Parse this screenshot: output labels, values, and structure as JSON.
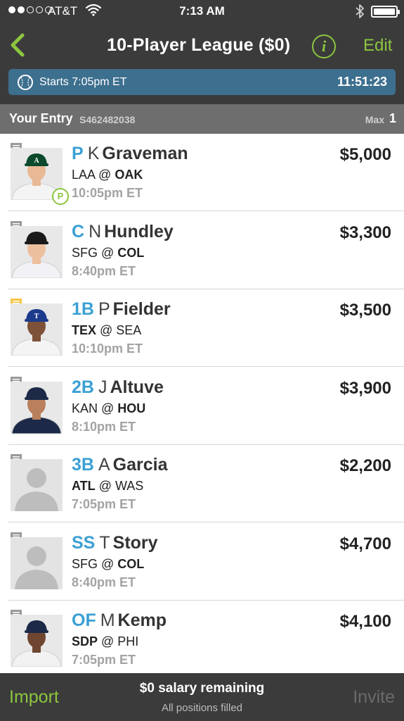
{
  "status_bar": {
    "carrier": "AT&T",
    "time": "7:13 AM",
    "signal_bars_filled": 2,
    "signal_bars_total": 5,
    "icons": [
      "wifi-icon",
      "bluetooth-icon",
      "battery-icon"
    ]
  },
  "nav": {
    "title": "10-Player League ($0)",
    "info_label": "i",
    "edit_label": "Edit",
    "icons": [
      "chevron-left-icon",
      "info-icon"
    ]
  },
  "start_banner": {
    "starts_text": "Starts 7:05pm ET",
    "countdown": "11:51:23",
    "icon": "baseball-icon"
  },
  "entry": {
    "label": "Your Entry",
    "id": "S462482038",
    "max_label": "Max",
    "max_value": "1"
  },
  "players": [
    {
      "pos": "P",
      "initial": "K",
      "last": "Graveman",
      "away": "LAA",
      "home": "OAK",
      "bold_team": "home",
      "time": "10:05pm ET",
      "salary": "$5,000",
      "photo": "player",
      "note_color": "#9a9a9a",
      "badge": "P",
      "cap": "#0b4a2c",
      "cap_logo": "A",
      "jersey": "#f4f4f4",
      "skin": "#e9b996"
    },
    {
      "pos": "C",
      "initial": "N",
      "last": "Hundley",
      "away": "SFG",
      "home": "COL",
      "bold_team": "home",
      "time": "8:40pm ET",
      "salary": "$3,300",
      "photo": "player",
      "note_color": "#9a9a9a",
      "badge": "",
      "cap": "#1a1a1a",
      "cap_logo": "",
      "jersey": "#f2f2f6",
      "skin": "#ecbf9f"
    },
    {
      "pos": "1B",
      "initial": "P",
      "last": "Fielder",
      "away": "TEX",
      "home": "SEA",
      "bold_team": "away",
      "time": "10:10pm ET",
      "salary": "$3,500",
      "photo": "player",
      "note_color": "#f5c542",
      "badge": "",
      "cap": "#1d3b8c",
      "cap_logo": "T",
      "jersey": "#f4f4f4",
      "skin": "#7d5238"
    },
    {
      "pos": "2B",
      "initial": "J",
      "last": "Altuve",
      "away": "KAN",
      "home": "HOU",
      "bold_team": "home",
      "time": "8:10pm ET",
      "salary": "$3,900",
      "photo": "player",
      "note_color": "#9a9a9a",
      "badge": "",
      "cap": "#1c2a48",
      "cap_logo": "",
      "jersey": "#1c2a48",
      "skin": "#b9805b"
    },
    {
      "pos": "3B",
      "initial": "A",
      "last": "Garcia",
      "away": "ATL",
      "home": "WAS",
      "bold_team": "away",
      "time": "7:05pm ET",
      "salary": "$2,200",
      "photo": "placeholder",
      "note_color": "#9a9a9a",
      "badge": ""
    },
    {
      "pos": "SS",
      "initial": "T",
      "last": "Story",
      "away": "SFG",
      "home": "COL",
      "bold_team": "home",
      "time": "8:40pm ET",
      "salary": "$4,700",
      "photo": "placeholder",
      "note_color": "#9a9a9a",
      "badge": ""
    },
    {
      "pos": "OF",
      "initial": "M",
      "last": "Kemp",
      "away": "SDP",
      "home": "PHI",
      "bold_team": "away",
      "time": "7:05pm ET",
      "salary": "$4,100",
      "photo": "player",
      "note_color": "#9a9a9a",
      "badge": "",
      "cap": "#1c2a48",
      "cap_logo": "",
      "jersey": "#f2f2f2",
      "skin": "#6f4630"
    }
  ],
  "footer": {
    "import_label": "Import",
    "remaining": "$0 salary remaining",
    "filled": "All positions filled",
    "invite_label": "Invite"
  },
  "colors": {
    "accent_green": "#8cc63f",
    "position_blue": "#3ba0d4",
    "banner_blue": "#3d6f8e",
    "bar_dark": "#3b3b3b",
    "entry_gray": "#6e6e6e"
  }
}
